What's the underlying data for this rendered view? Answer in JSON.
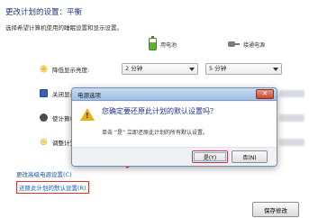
{
  "page": {
    "title": "更改计划的设置：平衡",
    "subtitle": "选择希望计算机使用的睡眠设置和显示设置。"
  },
  "columns": {
    "battery_label": "用电池",
    "plugged_label": "接通电源"
  },
  "rows": [
    {
      "label": "降低显示亮度:",
      "battery_value": "2 分钟",
      "plugged_value": "5 分钟"
    },
    {
      "label": "关闭显示器:",
      "battery_value": "",
      "plugged_value": ""
    },
    {
      "label": "使计算机进入",
      "battery_value": "",
      "plugged_value": ""
    },
    {
      "label": "调整计划亮度",
      "battery_value": "",
      "plugged_value": ""
    }
  ],
  "links": {
    "advanced": "更改高级电源设置(C)",
    "restore_defaults": "还原此计划的默认设置(R)"
  },
  "footer": {
    "save_label": "保存修改"
  },
  "dialog": {
    "title": "电源选项",
    "close_label": "✕",
    "question": "您确定要还原此计划的默认设置吗？",
    "description": "单击 “是” 立即还原此计划的所有默认设置。",
    "yes_label": "是(Y)",
    "no_label": "否(N)"
  },
  "colors": {
    "heading": "#1e3287",
    "highlight_red": "#e03030",
    "link": "#1a5aa0"
  }
}
